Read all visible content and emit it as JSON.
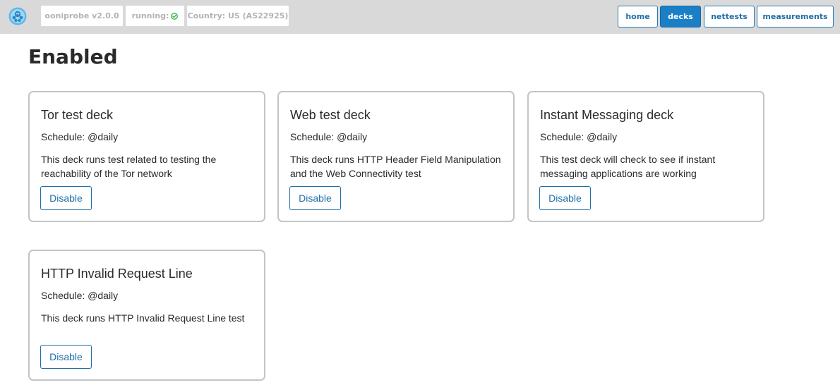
{
  "header": {
    "logo_icon": "octopus-logo-icon",
    "version_label": "ooniprobe v2.0.0",
    "running_label": "running:",
    "running_icon": "check-circle-icon",
    "running_color": "#3cb54a",
    "country_label": "Country: US (AS22925)",
    "nav": {
      "home": "home",
      "decks": "decks",
      "nettests": "nettests",
      "measurements": "measurements"
    },
    "active_nav": "decks",
    "accent_color": "#1b7fc6"
  },
  "main": {
    "title": "Enabled",
    "decks": [
      {
        "title": "Tor test deck",
        "schedule": "Schedule: @daily",
        "description": "This deck runs test related to testing the reachability of the Tor network",
        "button": "Disable"
      },
      {
        "title": "Web test deck",
        "schedule": "Schedule: @daily",
        "description": "This deck runs HTTP Header Field Manipulation and the Web Connectivity test",
        "button": "Disable"
      },
      {
        "title": "Instant Messaging deck",
        "schedule": "Schedule: @daily",
        "description": "This test deck will check to see if instant messaging applications are working",
        "button": "Disable"
      },
      {
        "title": "HTTP Invalid Request Line",
        "schedule": "Schedule: @daily",
        "description": "This deck runs HTTP Invalid Request Line test",
        "button": "Disable"
      }
    ]
  }
}
